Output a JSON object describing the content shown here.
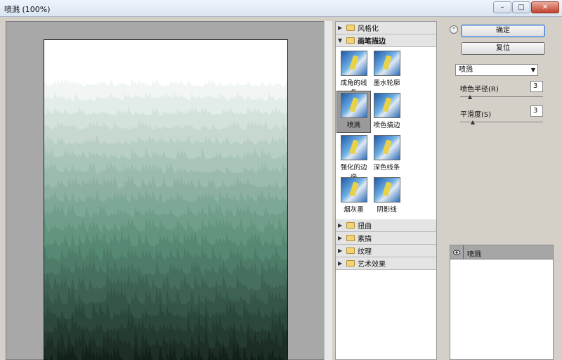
{
  "window": {
    "title": "喷溅 (100%)",
    "buttons": {
      "minimize": "–",
      "maximize": "□",
      "close": "✕"
    }
  },
  "preview": {
    "colors": {
      "light": "#ffffff",
      "mid": "#5a8f78",
      "dark": "#0b1410"
    }
  },
  "gallery": {
    "categories_top": [
      {
        "label": "风格化",
        "expanded": false
      }
    ],
    "open_category": {
      "label": "画笔描边",
      "expanded": true
    },
    "thumbnails": [
      {
        "label": "成角的线条",
        "selected": false
      },
      {
        "label": "墨水轮廓",
        "selected": false
      },
      {
        "label": "喷溅",
        "selected": true
      },
      {
        "label": "喷色描边",
        "selected": false
      },
      {
        "label": "强化的边缘",
        "selected": false
      },
      {
        "label": "深色线条",
        "selected": false
      },
      {
        "label": "烟灰墨",
        "selected": false
      },
      {
        "label": "阴影线",
        "selected": false
      }
    ],
    "categories_bottom": [
      {
        "label": "扭曲"
      },
      {
        "label": "素描"
      },
      {
        "label": "纹理"
      },
      {
        "label": "艺术效果"
      }
    ]
  },
  "controls": {
    "collapse_icon": "chevron-double-up",
    "ok_label": "确定",
    "reset_label": "复位",
    "filter_select": "喷溅",
    "params": [
      {
        "label": "喷色半径(R)",
        "value": "3",
        "level": 0.12
      },
      {
        "label": "平滑度(S)",
        "value": "3",
        "level": 0.15
      }
    ]
  },
  "layers": {
    "items": [
      {
        "label": "喷溅",
        "visible": true
      }
    ]
  }
}
